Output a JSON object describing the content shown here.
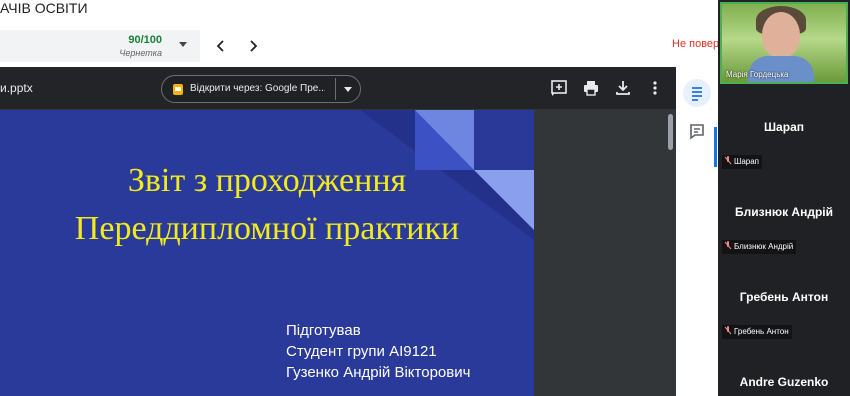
{
  "top": {
    "title": "АЧІВ ОСВІТИ",
    "grade": {
      "score": "90/100",
      "status": "Чернетка"
    },
    "unsubmit_text": "Не повер"
  },
  "viewer": {
    "file_name": "и.pptx",
    "open_with": "Відкрити через: Google Пре...",
    "slide": {
      "title_line1": "Звіт з проходження",
      "title_line2": "Переддипломної практики",
      "body": [
        "Підготував",
        "Студент групи  АІ9121",
        "Гузенко Андрій Вікторович"
      ]
    }
  },
  "meet": {
    "self_name": "Марія Гордецька",
    "participants": [
      {
        "name": "Шарап",
        "tag": "Шарап"
      },
      {
        "name": "Близнюк Андрій",
        "tag": "Близнюк Андрій"
      },
      {
        "name": "Гребень Антон",
        "tag": "Гребень Антон"
      },
      {
        "name": "Andre Guzenko",
        "tag": ""
      }
    ]
  },
  "icons": {
    "add_comment": "add-comment-icon",
    "print": "print-icon",
    "download": "download-icon",
    "more": "more-vert-icon",
    "side_details": "description-icon",
    "side_comments": "comment-icon"
  },
  "colors": {
    "slide_background": "#2a3a9a",
    "slide_title": "#f2ea1a",
    "grade": "#188038",
    "unsubmit": "#d93025",
    "accent": "#1a73e8"
  }
}
